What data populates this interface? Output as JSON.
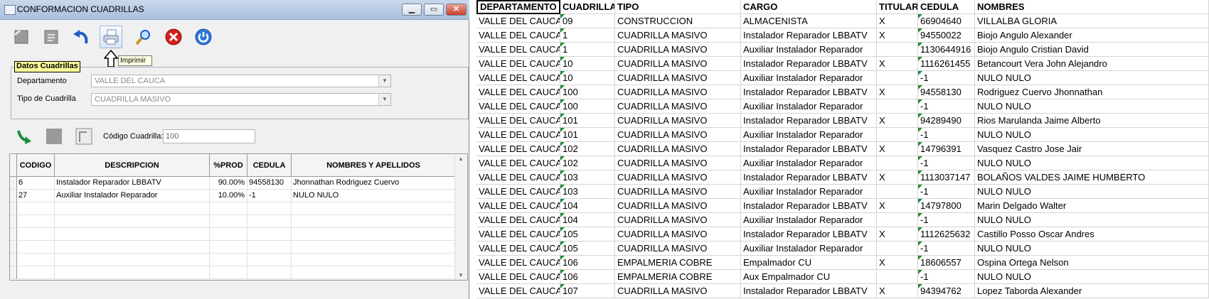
{
  "window": {
    "title": "CONFORMACION CUADRILLAS",
    "tooltip": "Imprimir",
    "group_title": "Datos Cuadrillas",
    "departamento_label": "Departamento",
    "departamento_value": "VALLE DEL CAUCA",
    "tipo_label": "Tipo de Cuadrilla",
    "tipo_value": "CUADRILLA MASIVO",
    "codigo_label": "Código Cuadrilla:",
    "codigo_value": "100"
  },
  "toolbar_icons": [
    "new-doc-icon",
    "edit-doc-icon",
    "undo-icon",
    "print-icon",
    "search-icon",
    "delete-icon",
    "power-icon"
  ],
  "grid": {
    "headers": [
      "CODIGO",
      "DESCRIPCION",
      "%PROD",
      "CEDULA",
      "NOMBRES Y APELLIDOS"
    ],
    "rows": [
      [
        "6",
        "Instalador Reparador LBBATV",
        "90.00%",
        "94558130",
        "Jhonnathan Rodriguez Cuervo"
      ],
      [
        "27",
        "Auxiliar Instalador Reparador",
        "10.00%",
        "-1",
        "NULO NULO"
      ]
    ]
  },
  "sheet": {
    "headers": [
      "DEPARTAMENTO",
      "CUADRILLA",
      "TIPO",
      "CARGO",
      "TITULAR",
      "CEDULA",
      "NOMBRES"
    ],
    "rows": [
      [
        "VALLE DEL CAUCA",
        "09",
        "CONSTRUCCION",
        "ALMACENISTA",
        "X",
        "66904640",
        "VILLALBA GLORIA"
      ],
      [
        "VALLE DEL CAUCA",
        "1",
        "CUADRILLA MASIVO",
        "Instalador Reparador LBBATV",
        "X",
        "94550022",
        "Biojo Angulo Alexander"
      ],
      [
        "VALLE DEL CAUCA",
        "1",
        "CUADRILLA MASIVO",
        "Auxiliar Instalador Reparador",
        "",
        "1130644916",
        "Biojo Angulo Cristian David"
      ],
      [
        "VALLE DEL CAUCA",
        "10",
        "CUADRILLA MASIVO",
        "Instalador Reparador LBBATV",
        "X",
        "1116261455",
        "Betancourt Vera John Alejandro"
      ],
      [
        "VALLE DEL CAUCA",
        "10",
        "CUADRILLA MASIVO",
        "Auxiliar Instalador Reparador",
        "",
        "-1",
        "NULO NULO"
      ],
      [
        "VALLE DEL CAUCA",
        "100",
        "CUADRILLA MASIVO",
        "Instalador Reparador LBBATV",
        "X",
        "94558130",
        "Rodriguez Cuervo Jhonnathan"
      ],
      [
        "VALLE DEL CAUCA",
        "100",
        "CUADRILLA MASIVO",
        "Auxiliar Instalador Reparador",
        "",
        "-1",
        "NULO NULO"
      ],
      [
        "VALLE DEL CAUCA",
        "101",
        "CUADRILLA MASIVO",
        "Instalador Reparador LBBATV",
        "X",
        "94289490",
        "Rios Marulanda Jaime Alberto"
      ],
      [
        "VALLE DEL CAUCA",
        "101",
        "CUADRILLA MASIVO",
        "Auxiliar Instalador Reparador",
        "",
        "-1",
        "NULO NULO"
      ],
      [
        "VALLE DEL CAUCA",
        "102",
        "CUADRILLA MASIVO",
        "Instalador Reparador LBBATV",
        "X",
        "14796391",
        "Vasquez Castro Jose Jair"
      ],
      [
        "VALLE DEL CAUCA",
        "102",
        "CUADRILLA MASIVO",
        "Auxiliar Instalador Reparador",
        "",
        "-1",
        "NULO NULO"
      ],
      [
        "VALLE DEL CAUCA",
        "103",
        "CUADRILLA MASIVO",
        "Instalador Reparador LBBATV",
        "X",
        "1113037147",
        "BOLAÑOS VALDES JAIME HUMBERTO"
      ],
      [
        "VALLE DEL CAUCA",
        "103",
        "CUADRILLA MASIVO",
        "Auxiliar Instalador Reparador",
        "",
        "-1",
        "NULO NULO"
      ],
      [
        "VALLE DEL CAUCA",
        "104",
        "CUADRILLA MASIVO",
        "Instalador Reparador LBBATV",
        "X",
        "14797800",
        "Marin Delgado Walter"
      ],
      [
        "VALLE DEL CAUCA",
        "104",
        "CUADRILLA MASIVO",
        "Auxiliar Instalador Reparador",
        "",
        "-1",
        "NULO NULO"
      ],
      [
        "VALLE DEL CAUCA",
        "105",
        "CUADRILLA MASIVO",
        "Instalador Reparador LBBATV",
        "X",
        "1112625632",
        "Castillo Posso Oscar Andres"
      ],
      [
        "VALLE DEL CAUCA",
        "105",
        "CUADRILLA MASIVO",
        "Auxiliar Instalador Reparador",
        "",
        "-1",
        "NULO NULO"
      ],
      [
        "VALLE DEL CAUCA",
        "106",
        "EMPALMERIA COBRE",
        "Empalmador CU",
        "X",
        "18606557",
        "Ospina Ortega Nelson"
      ],
      [
        "VALLE DEL CAUCA",
        "106",
        "EMPALMERIA COBRE",
        "Aux Empalmador CU",
        "",
        "-1",
        "NULO NULO"
      ],
      [
        "VALLE DEL CAUCA",
        "107",
        "CUADRILLA MASIVO",
        "Instalador Reparador LBBATV",
        "X",
        "94394762",
        "Lopez Taborda Alexander"
      ]
    ]
  },
  "colors": {
    "accent": "#1e5fc4",
    "delete": "#d32020",
    "indicator": "#1e8c3a"
  }
}
